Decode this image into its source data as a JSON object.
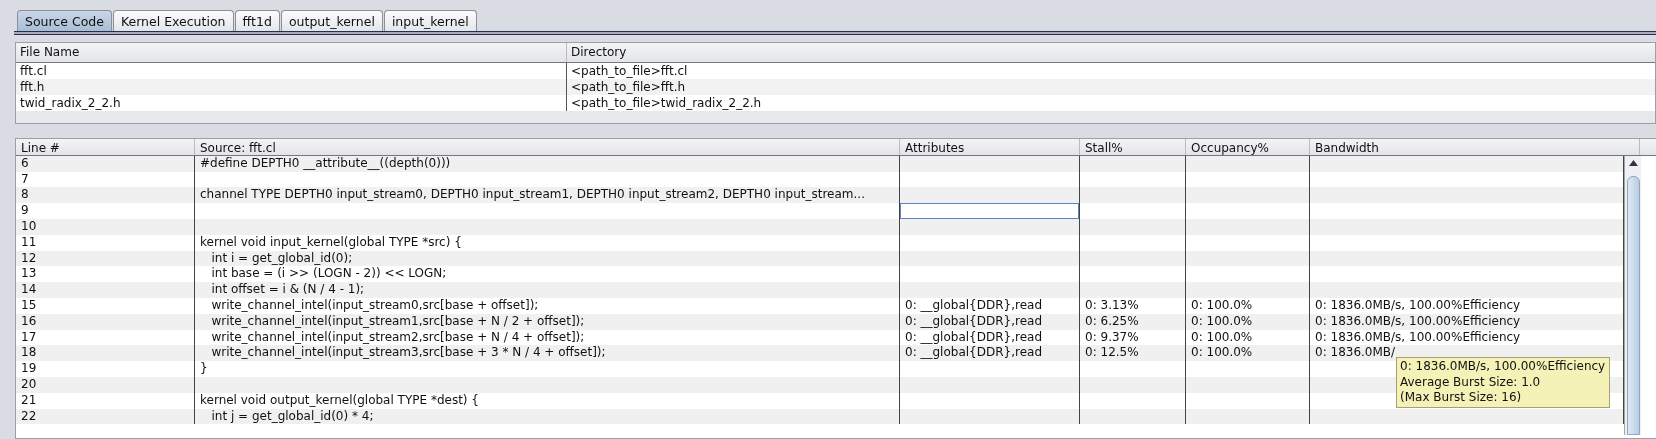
{
  "tabs": [
    {
      "label": "Source Code",
      "selected": true
    },
    {
      "label": "Kernel Execution",
      "selected": false
    },
    {
      "label": "fft1d",
      "selected": false
    },
    {
      "label": "output_kernel",
      "selected": false
    },
    {
      "label": "input_kernel",
      "selected": false
    }
  ],
  "files": {
    "columns": [
      "File Name",
      "Directory"
    ],
    "rows": [
      [
        "fft.cl",
        "<path_to_file>fft.cl"
      ],
      [
        "fft.h",
        "<path_to_file>fft.h"
      ],
      [
        "twid_radix_2_2.h",
        "<path_to_file>twid_radix_2_2.h"
      ]
    ]
  },
  "source": {
    "columns": [
      "Line #",
      "Source: fft.cl",
      "Attributes",
      "Stall%",
      "Occupancy%",
      "Bandwidth"
    ],
    "rows": [
      {
        "line": "6",
        "code": "#define DEPTH0 __attribute__((depth(0)))",
        "focused": false
      },
      {
        "line": "7",
        "focused": false
      },
      {
        "line": "8",
        "code": "channel TYPE DEPTH0 input_stream0, DEPTH0 input_stream1, DEPTH0 input_stream2, DEPTH0 input_stream...",
        "focused": false
      },
      {
        "line": "9",
        "focused": true
      },
      {
        "line": "10",
        "focused": false
      },
      {
        "line": "11",
        "code": "kernel void input_kernel(global TYPE *src) {",
        "focused": false
      },
      {
        "line": "12",
        "code": "   int i = get_global_id(0);",
        "focused": false
      },
      {
        "line": "13",
        "code": "   int base = (i >> (LOGN - 2)) << LOGN;",
        "focused": false
      },
      {
        "line": "14",
        "code": "   int offset = i & (N / 4 - 1);",
        "focused": false
      },
      {
        "line": "15",
        "code": "   write_channel_intel(input_stream0,src[base + offset]);",
        "attributes": "0: __global{DDR},read",
        "stall": "0: 3.13%",
        "occupancy": "0: 100.0%",
        "bandwidth": "0: 1836.0MB/s, 100.00%Efficiency",
        "focused": false
      },
      {
        "line": "16",
        "code": "   write_channel_intel(input_stream1,src[base + N / 2 + offset]);",
        "attributes": "0: __global{DDR},read",
        "stall": "0: 6.25%",
        "occupancy": "0: 100.0%",
        "bandwidth": "0: 1836.0MB/s, 100.00%Efficiency",
        "focused": false
      },
      {
        "line": "17",
        "code": "   write_channel_intel(input_stream2,src[base + N / 4 + offset]);",
        "attributes": "0: __global{DDR},read",
        "stall": "0: 9.37%",
        "occupancy": "0: 100.0%",
        "bandwidth": "0: 1836.0MB/s, 100.00%Efficiency",
        "focused": false
      },
      {
        "line": "18",
        "code": "   write_channel_intel(input_stream3,src[base + 3 * N / 4 + offset]);",
        "attributes": "0: __global{DDR},read",
        "stall": "0: 12.5%",
        "occupancy": "0: 100.0%",
        "bandwidth": "0: 1836.0MB/",
        "focused": false
      },
      {
        "line": "19",
        "code": "}",
        "focused": false
      },
      {
        "line": "20",
        "focused": false
      },
      {
        "line": "21",
        "code": "kernel void output_kernel(global TYPE *dest) {",
        "focused": false
      },
      {
        "line": "22",
        "code": "   int j = get_global_id(0) * 4;",
        "focused": false
      }
    ]
  },
  "tooltip": {
    "lines": [
      "0: 1836.0MB/s, 100.00%Efficiency",
      "Average Burst Size: 1.0",
      "(Max Burst Size: 16)"
    ]
  }
}
